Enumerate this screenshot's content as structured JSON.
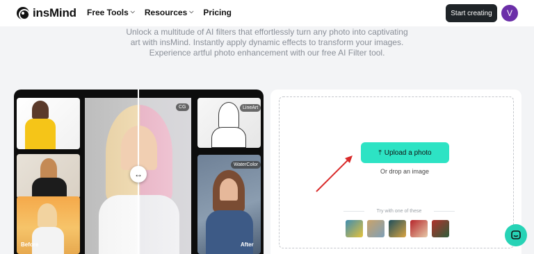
{
  "header": {
    "logo_text": "insMind",
    "nav": [
      {
        "label": "Free Tools",
        "has_dropdown": true
      },
      {
        "label": "Resources",
        "has_dropdown": true
      },
      {
        "label": "Pricing",
        "has_dropdown": false
      }
    ],
    "start_button": "Start creating",
    "avatar_letter": "V"
  },
  "description": "Unlock a multitude of AI filters that effortlessly turn any photo into captivating art with insMind. Instantly apply dynamic effects to transform your images. Experience artful photo enhancement with our free AI Filter tool.",
  "showcase": {
    "tags": {
      "cg": "CG",
      "lineart": "LineArt",
      "watercolor": "WaterColor"
    },
    "before": "Before",
    "after": "After",
    "handle_icon": "↔"
  },
  "upload": {
    "button_label": "Upload a photo",
    "drop_text": "Or drop an image",
    "try_label": "Try with one of these",
    "sample_colors": [
      "#3f8db0",
      "#c9a26a",
      "#1f4f5c",
      "#b5252a",
      "#b0312b"
    ]
  },
  "colors": {
    "accent": "#2de3c4",
    "dark_button": "#1f2428",
    "avatar": "#6b2fa8",
    "arrow": "#d92a2a"
  }
}
